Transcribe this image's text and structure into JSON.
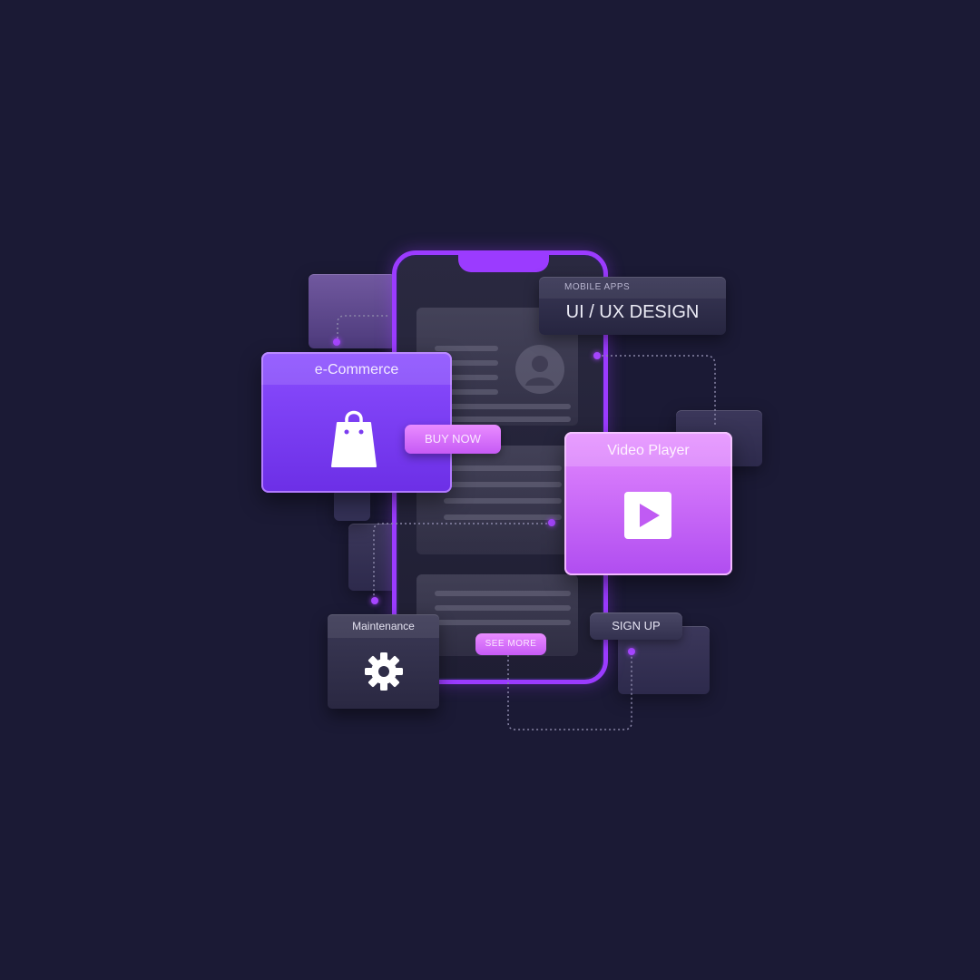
{
  "labels": {
    "ecommerce_title": "e-Commerce",
    "buy_now": "BUY NOW",
    "mobile_apps": "MOBILE APPS",
    "ui_ux_design": "UI / UX DESIGN",
    "video_player_title": "Video Player",
    "maintenance_title": "Maintenance",
    "see_more": "SEE MORE",
    "sign_up": "SIGN UP"
  },
  "colors": {
    "background": "#1b1a35",
    "accent_purple": "#9b3bff",
    "accent_pink": "#e489ff"
  },
  "icons": {
    "ecommerce": "shopping-bag-icon",
    "video": "play-icon",
    "maintenance": "gear-icon",
    "profile": "user-avatar-icon"
  }
}
